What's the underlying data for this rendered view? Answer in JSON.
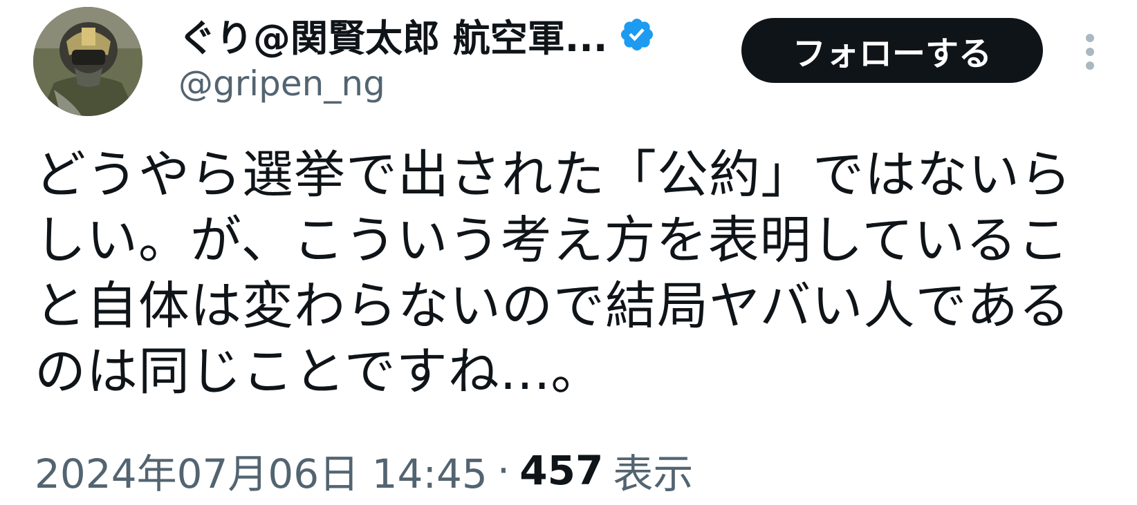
{
  "author": {
    "display_name": "ぐり@関賢太郎 航空軍...",
    "handle": "@gripen_ng",
    "verified": true
  },
  "actions": {
    "follow_label": "フォローする",
    "more_icon": "more-vertical-icon"
  },
  "tweet": {
    "lines": [
      "どうやら選挙で出された「公約」ではないら",
      "しい。が、こういう考え方を表明しているこ",
      "と自体は変わらないので結局ヤバい人である",
      "のは同じことですね...。"
    ]
  },
  "meta": {
    "timestamp": "2024年07月06日 14:45",
    "separator": "·",
    "views_count": "457",
    "views_label": "表示"
  },
  "colors": {
    "text_primary": "#0f1419",
    "text_secondary": "#536471",
    "verified_blue": "#1d9bf0",
    "follow_bg": "#0f1419"
  }
}
